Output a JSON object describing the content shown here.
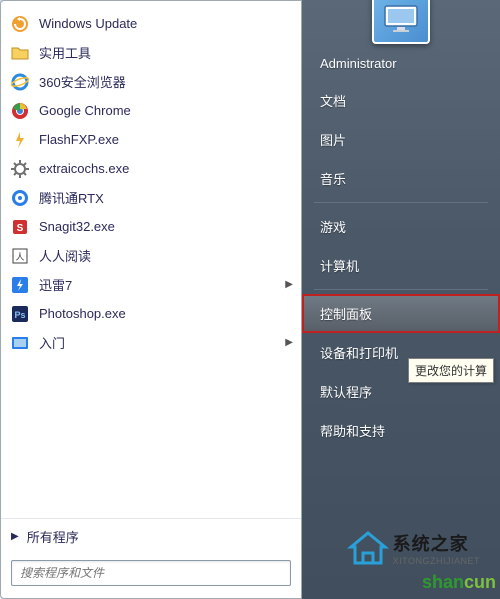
{
  "programs": [
    {
      "label": "Windows Update",
      "icon": "windows-update-icon",
      "arrow": false
    },
    {
      "label": "实用工具",
      "icon": "folder-icon",
      "arrow": false
    },
    {
      "label": "360安全浏览器",
      "icon": "ie-icon",
      "arrow": false
    },
    {
      "label": "Google Chrome",
      "icon": "chrome-icon",
      "arrow": false
    },
    {
      "label": "FlashFXP.exe",
      "icon": "flashfxp-icon",
      "arrow": false
    },
    {
      "label": "extraicochs.exe",
      "icon": "cog-icon",
      "arrow": false
    },
    {
      "label": "腾讯通RTX",
      "icon": "rtx-icon",
      "arrow": false
    },
    {
      "label": "Snagit32.exe",
      "icon": "snagit-icon",
      "arrow": false
    },
    {
      "label": "人人阅读",
      "icon": "renren-icon",
      "arrow": false
    },
    {
      "label": "迅雷7",
      "icon": "xunlei-icon",
      "arrow": true
    },
    {
      "label": "Photoshop.exe",
      "icon": "photoshop-icon",
      "arrow": false
    },
    {
      "label": "入门",
      "icon": "getting-started-icon",
      "arrow": true
    }
  ],
  "all_programs_label": "所有程序",
  "search_placeholder": "搜索程序和文件",
  "user_name": "Administrator",
  "right_items": [
    {
      "label": "文档",
      "key": "documents"
    },
    {
      "label": "图片",
      "key": "pictures"
    },
    {
      "label": "音乐",
      "key": "music"
    },
    {
      "label": "游戏",
      "key": "games",
      "sep_before": true
    },
    {
      "label": "计算机",
      "key": "computer"
    },
    {
      "label": "控制面板",
      "key": "control-panel",
      "sep_before": true,
      "highlighted": true
    },
    {
      "label": "设备和打印机",
      "key": "devices-printers"
    },
    {
      "label": "默认程序",
      "key": "default-programs"
    },
    {
      "label": "帮助和支持",
      "key": "help-support"
    }
  ],
  "tooltip_text": "更改您的计算",
  "watermark": {
    "cn": "系统之家",
    "en": "XITONGZHIJIANET"
  },
  "watermark2": "shancun",
  "icon_colors": {
    "windows-update-icon": "#f0a030",
    "folder-icon": "#f8d060",
    "ie-icon": "#2e8adf",
    "chrome-icon": "#d03030",
    "flashfxp-icon": "#f0b030",
    "cog-icon": "#707070",
    "rtx-icon": "#2a7eea",
    "snagit-icon": "#d03030",
    "renren-icon": "#404040",
    "xunlei-icon": "#2a7eea",
    "photoshop-icon": "#1a2a5a",
    "getting-started-icon": "#2a7eea"
  }
}
